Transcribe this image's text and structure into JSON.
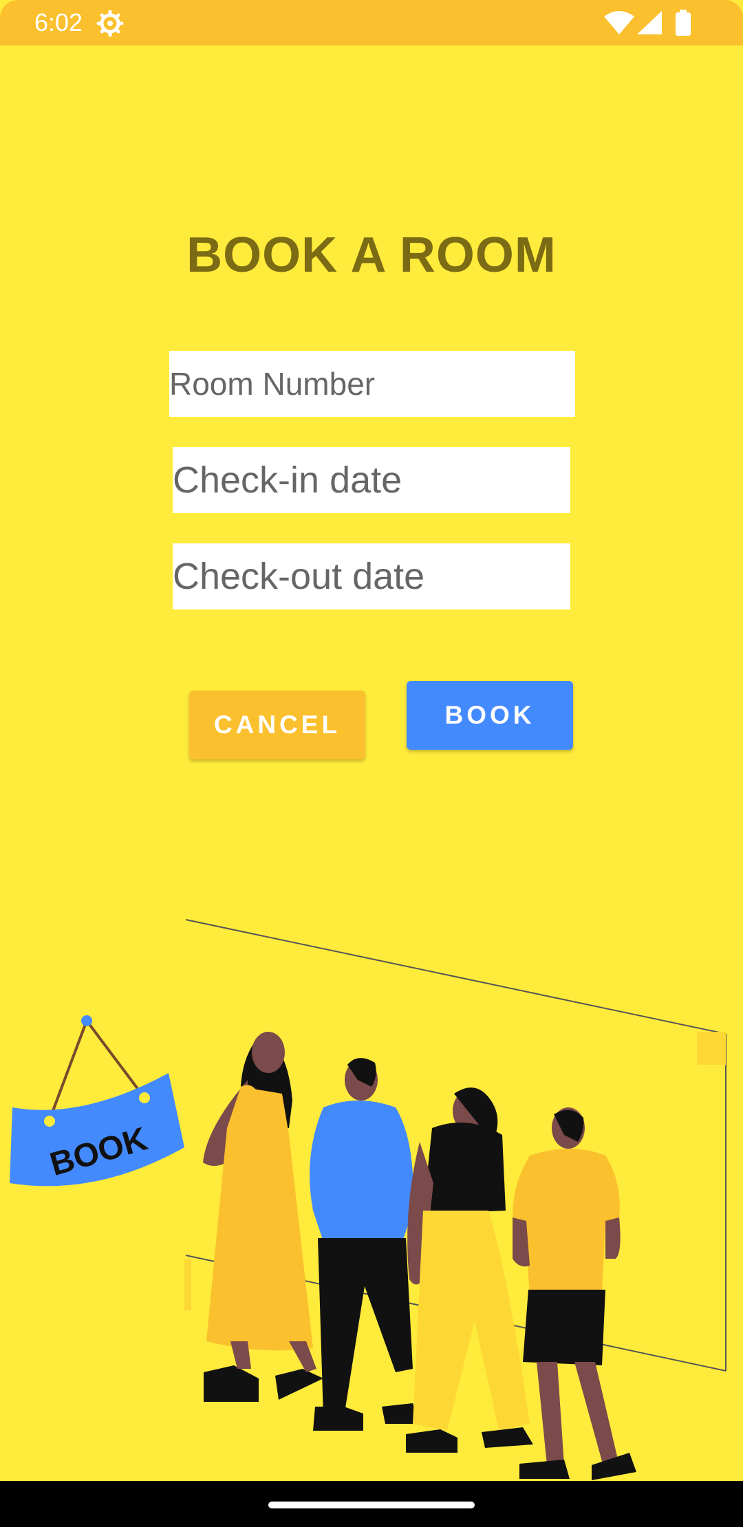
{
  "status_bar": {
    "time": "6:02",
    "icons": [
      "settings-icon",
      "wifi-icon",
      "signal-icon",
      "battery-icon"
    ]
  },
  "form": {
    "title": "BOOK A ROOM",
    "room_number_placeholder": "Room Number",
    "checkin_placeholder": "Check-in date",
    "checkout_placeholder": "Check-out date"
  },
  "buttons": {
    "cancel_label": "CANCEL",
    "book_label": "BOOK"
  },
  "illustration": {
    "sign_text": "BOOK"
  },
  "colors": {
    "background": "#FFEB3B",
    "status_bar": "#FBC02D",
    "title": "#7B6B14",
    "cancel": "#FBC02D",
    "book": "#448AFF"
  }
}
